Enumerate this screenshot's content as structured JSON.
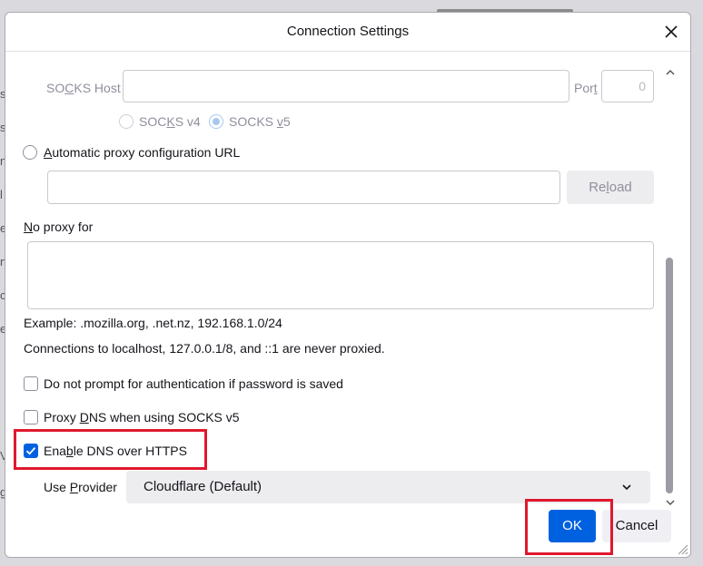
{
  "window": {
    "title": "Connection Settings",
    "close_icon": "close-icon"
  },
  "socks": {
    "host_label_pre": "SO",
    "host_label_u": "C",
    "host_label_post": "KS Host",
    "host_value": "",
    "port_label_pre": "Por",
    "port_label_u": "t",
    "port_value": "0",
    "v4_label_pre": "SOC",
    "v4_label_u": "K",
    "v4_label_post": "S v4",
    "v5_label_pre": "SOCKS ",
    "v5_label_u": "v",
    "v5_label_post": "5",
    "selected_version": "SOCKS v5"
  },
  "auto_proxy": {
    "label_u": "A",
    "label_post": "utomatic proxy configuration URL",
    "url_value": "",
    "reload_pre": "Re",
    "reload_u": "l",
    "reload_post": "oad"
  },
  "no_proxy": {
    "label_u": "N",
    "label_post": "o proxy for",
    "value": "",
    "example": "Example: .mozilla.org, .net.nz, 192.168.1.0/24",
    "note": "Connections to localhost, 127.0.0.1/8, and ::1 are never proxied."
  },
  "options": {
    "no_prompt_label": "Do not prompt for authentication if password is saved",
    "no_prompt_checked": false,
    "proxy_dns_pre": "Proxy ",
    "proxy_dns_u": "D",
    "proxy_dns_post": "NS when using SOCKS v5",
    "proxy_dns_checked": false,
    "doh_pre": "Ena",
    "doh_u": "b",
    "doh_post": "le DNS over HTTPS",
    "doh_checked": true
  },
  "provider": {
    "label_pre": "Use ",
    "label_u": "P",
    "label_post": "rovider",
    "selected": "Cloudflare (Default)",
    "chevron_icon": "chevron-down-icon"
  },
  "footer": {
    "ok_label": "OK",
    "cancel_label": "Cancel"
  },
  "colors": {
    "accent": "#0061e0",
    "highlight": "#e0182d"
  }
}
